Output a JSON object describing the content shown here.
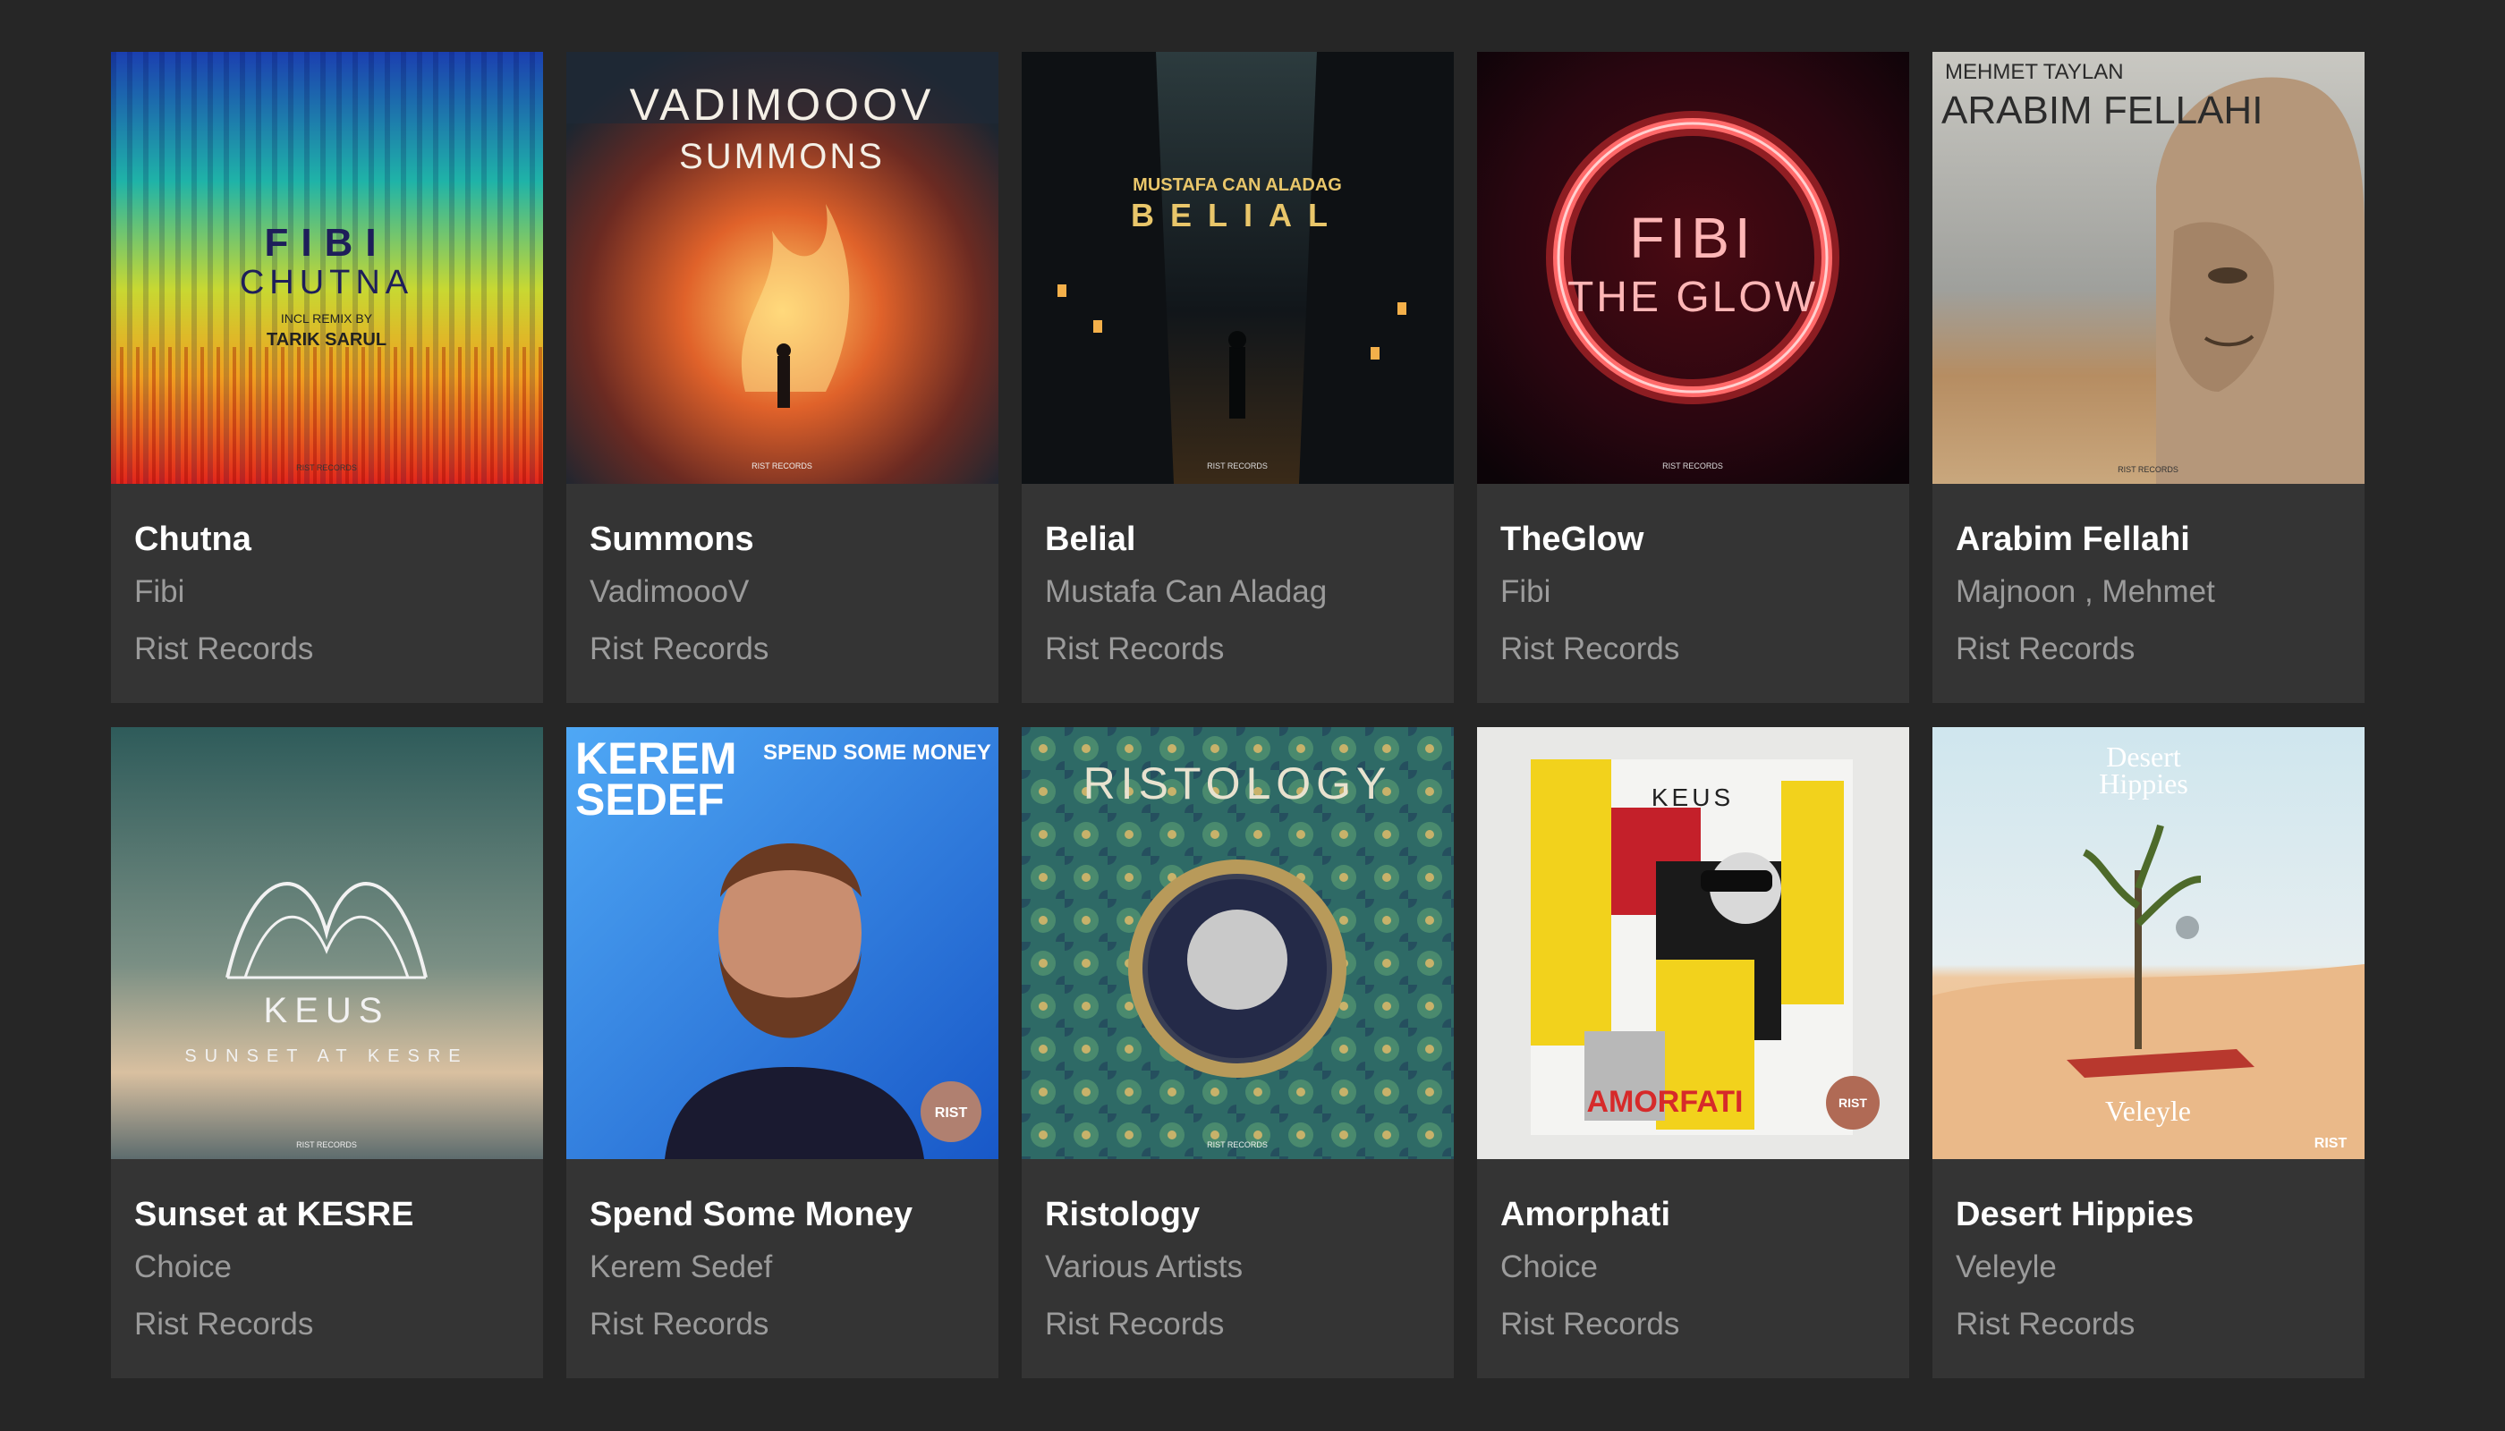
{
  "releases": [
    {
      "title": "Chutna",
      "artist": "Fibi",
      "label": "Rist Records",
      "cover": {
        "icon": "spectrogram-cover",
        "lines": [
          "FIBI",
          "CHUTNA",
          "INCL REMIX BY",
          "TARIK SARUL"
        ],
        "badge": "RIST RECORDS"
      }
    },
    {
      "title": "Summons",
      "artist": "VadimoooV",
      "label": "Rist Records",
      "cover": {
        "icon": "fire-figure-cover",
        "lines": [
          "VADIMOOOV",
          "SUMMONS"
        ],
        "badge": "RIST RECORDS"
      }
    },
    {
      "title": "Belial",
      "artist": "Mustafa Can Aladag",
      "label": "Rist Records",
      "cover": {
        "icon": "dark-city-cover",
        "lines": [
          "MUSTAFA CAN ALADAG",
          "BELIAL"
        ],
        "badge": "RIST RECORDS"
      }
    },
    {
      "title": "TheGlow",
      "artist": "Fibi",
      "label": "Rist Records",
      "cover": {
        "icon": "red-ring-cover",
        "lines": [
          "FIBI",
          "THE GLOW"
        ],
        "badge": "RIST RECORDS"
      }
    },
    {
      "title": "Arabim Fellahi",
      "artist": "Majnoon , Mehmet",
      "label": "Rist Records",
      "cover": {
        "icon": "stone-face-cover",
        "lines": [
          "MEHMET TAYLAN",
          "ARABIM FELLAHI"
        ],
        "badge": "RIST RECORDS"
      }
    },
    {
      "title": "Sunset at KESRE",
      "artist": "Choice",
      "label": "Rist Records",
      "cover": {
        "icon": "keus-sunset-cover",
        "lines": [
          "KEUS",
          "SUNSET AT KESRE"
        ],
        "badge": "RIST RECORDS"
      }
    },
    {
      "title": "Spend Some Money",
      "artist": "Kerem Sedef",
      "label": "Rist Records",
      "cover": {
        "icon": "bearded-man-cover",
        "lines": [
          "KEREM",
          "SEDEF",
          "SPEND SOME MONEY"
        ],
        "badge": "RIST"
      }
    },
    {
      "title": "Ristology",
      "artist": "Various Artists",
      "label": "Rist Records",
      "cover": {
        "icon": "ornament-cover",
        "lines": [
          "RISTOLOGY"
        ],
        "badge": "RIST RECORDS"
      }
    },
    {
      "title": "Amorphati",
      "artist": "Choice",
      "label": "Rist Records",
      "cover": {
        "icon": "collage-cover",
        "lines": [
          "KEUS",
          "AMORFATI"
        ],
        "badge": "RIST"
      }
    },
    {
      "title": "Desert Hippies",
      "artist": "Veleyle",
      "label": "Rist Records",
      "cover": {
        "icon": "desert-tree-cover",
        "lines": [
          "Desert",
          "Hippies",
          "Veleyle"
        ],
        "badge": "RIST"
      }
    }
  ]
}
